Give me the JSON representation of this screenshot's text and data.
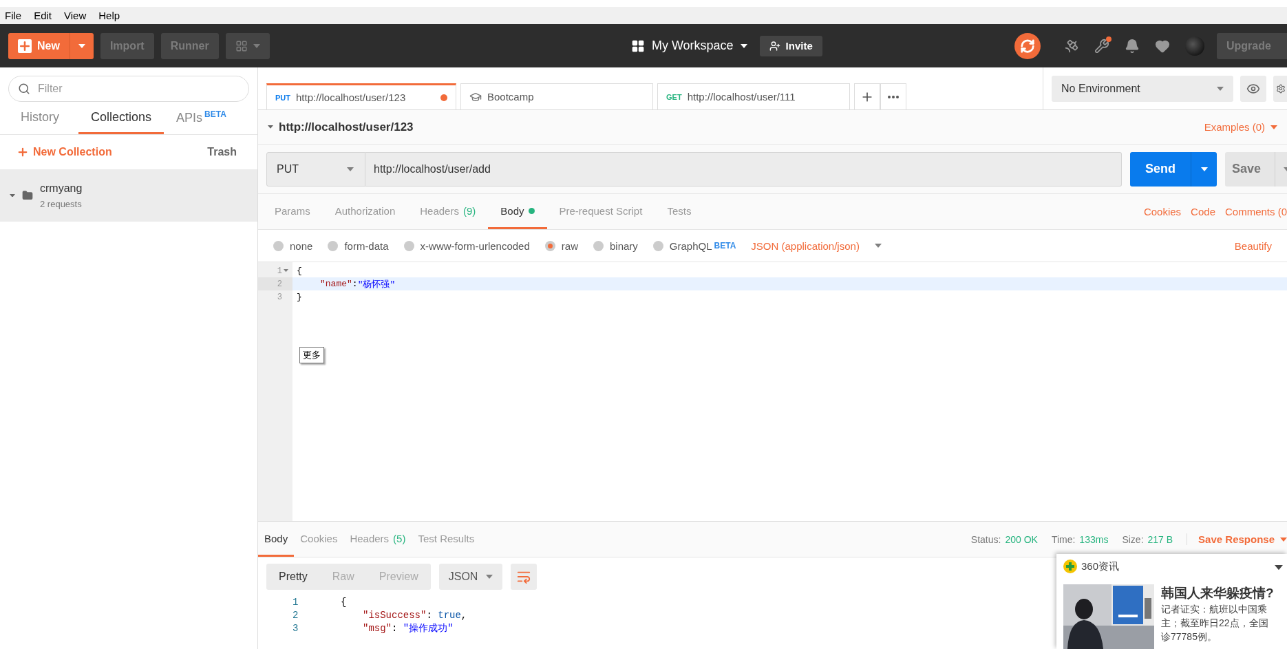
{
  "menu": [
    "File",
    "Edit",
    "View",
    "Help"
  ],
  "header": {
    "new_button": "New",
    "import_button": "Import",
    "runner_button": "Runner",
    "workspace": "My Workspace",
    "invite_button": "Invite",
    "upgrade_button": "Upgrade",
    "notification": true
  },
  "sidebar": {
    "filter": {
      "placeholder": "Filter"
    },
    "tabs": [
      {
        "label": "History",
        "selected": false
      },
      {
        "label": "Collections",
        "selected": true
      },
      {
        "label": "APIs",
        "badge": "BETA",
        "selected": false
      }
    ],
    "new_collection": "New Collection",
    "trash": "Trash",
    "collections": [
      {
        "name": "crmyang",
        "count": "2 requests",
        "selected": true
      }
    ]
  },
  "open_tabs": [
    {
      "kind": "request",
      "method": "PUT",
      "label": "http://localhost/user/123",
      "selected": true,
      "unsaved": true
    },
    {
      "kind": "bootcamp",
      "label": "Bootcamp",
      "selected": false,
      "unsaved": false
    },
    {
      "kind": "request",
      "method": "GET",
      "label": "http://localhost/user/111",
      "selected": false,
      "unsaved": false
    }
  ],
  "environment": "No Environment",
  "request": {
    "title": "http://localhost/user/123",
    "examples": "Examples (0)",
    "method": "PUT",
    "url": "http://localhost/user/add",
    "send_button": "Send",
    "save_button": "Save",
    "tabs": [
      {
        "label": "Params",
        "selected": false
      },
      {
        "label": "Authorization",
        "selected": false
      },
      {
        "label": "Headers",
        "count": "(9)",
        "selected": false
      },
      {
        "label": "Body",
        "selected": true,
        "dot": true
      },
      {
        "label": "Pre-request Script",
        "selected": false
      },
      {
        "label": "Tests",
        "selected": false
      }
    ],
    "links": [
      "Cookies",
      "Code",
      "Comments (0"
    ],
    "body_types": [
      {
        "label": "none",
        "selected": false
      },
      {
        "label": "form-data",
        "selected": false
      },
      {
        "label": "x-www-form-urlencoded",
        "selected": false
      },
      {
        "label": "raw",
        "selected": true
      },
      {
        "label": "binary",
        "selected": false
      },
      {
        "label": "GraphQL",
        "badge": "BETA",
        "selected": false
      }
    ],
    "body_format": "JSON (application/json)",
    "beautify": "Beautify",
    "editor": [
      {
        "number": "1",
        "active": false,
        "tokens": [
          {
            "kind": "punct",
            "text": "{"
          }
        ]
      },
      {
        "number": "2",
        "active": true,
        "tokens": [
          {
            "kind": "key",
            "text": "\"name\""
          },
          {
            "kind": "punct",
            "text": ":"
          },
          {
            "kind": "string",
            "text": "\"杨怀强\""
          }
        ]
      },
      {
        "number": "3",
        "active": false,
        "tokens": [
          {
            "kind": "punct",
            "text": "}"
          }
        ]
      }
    ],
    "tooltip": "更多"
  },
  "response": {
    "tabs": [
      {
        "label": "Body",
        "selected": true
      },
      {
        "label": "Cookies",
        "selected": false
      },
      {
        "label": "Headers",
        "count": "(5)",
        "selected": false
      },
      {
        "label": "Test Results",
        "selected": false
      }
    ],
    "stats": [
      {
        "label": "Status:",
        "value": "200 OK"
      },
      {
        "label": "Time:",
        "value": "133ms"
      },
      {
        "label": "Size:",
        "value": "217 B"
      }
    ],
    "save_response": "Save Response",
    "view_modes": [
      {
        "label": "Pretty",
        "selected": true
      },
      {
        "label": "Raw",
        "selected": false
      },
      {
        "label": "Preview",
        "selected": false
      }
    ],
    "format": "JSON",
    "lines": [
      {
        "number": "1",
        "tokens": [
          {
            "kind": "punct",
            "text": "{"
          }
        ]
      },
      {
        "number": "2",
        "tokens": [
          {
            "kind": "key",
            "text": "\"isSuccess\""
          },
          {
            "kind": "punct",
            "text": ": "
          },
          {
            "kind": "literal",
            "text": "true"
          },
          {
            "kind": "punct",
            "text": ","
          }
        ]
      },
      {
        "number": "3",
        "tokens": [
          {
            "kind": "key",
            "text": "\"msg\""
          },
          {
            "kind": "punct",
            "text": ": "
          },
          {
            "kind": "string",
            "text": "\"操作成功\""
          }
        ]
      }
    ]
  },
  "news_popup": {
    "source": "360资讯",
    "headline": "韩国人来华躲疫情?",
    "summary_lines": [
      "记者证实：航班以中国乘",
      "主；截至昨日22点，全国",
      "诊77785例。"
    ],
    "image": {
      "kind": "picture"
    }
  }
}
